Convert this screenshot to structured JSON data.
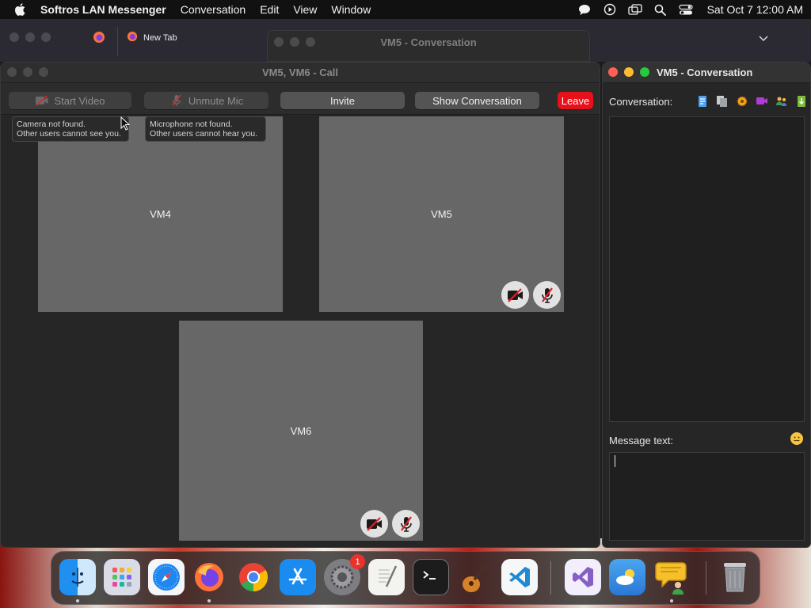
{
  "menubar": {
    "app_name": "Softros LAN Messenger",
    "items": [
      "Conversation",
      "Edit",
      "View",
      "Window"
    ],
    "clock": "Sat Oct 7  12:00 AM",
    "status_icons": [
      "chat-bubble-icon",
      "play-icon",
      "screen-mirror-icon",
      "search-icon",
      "control-center-icon"
    ]
  },
  "browser": {
    "tab_title": "New Tab"
  },
  "background_window": {
    "title": "VM5 - Conversation"
  },
  "call_window": {
    "title": "VM5, VM6 - Call",
    "toolbar": {
      "start_video": "Start Video",
      "unmute_mic": "Unmute Mic",
      "invite": "Invite",
      "show_conversation": "Show Conversation",
      "leave": "Leave"
    },
    "tooltips": {
      "camera": [
        "Camera not found.",
        "Other users cannot see you."
      ],
      "microphone": [
        "Microphone not found.",
        "Other users cannot hear you."
      ]
    },
    "participants": [
      {
        "name": "VM4"
      },
      {
        "name": "VM5"
      },
      {
        "name": "VM6"
      }
    ]
  },
  "conversation_window": {
    "title": "VM5 - Conversation",
    "conversation_label": "Conversation:",
    "message_label": "Message text:",
    "message_value": "",
    "toolbar_icons": [
      "history-icon",
      "copy-icon",
      "settings-icon",
      "video-call-icon",
      "add-users-icon",
      "file-transfer-icon"
    ]
  },
  "dock": {
    "apps": [
      "Finder",
      "Launchpad",
      "Safari",
      "Firefox",
      "Chrome",
      "App Store",
      "System Settings",
      "TextEdit",
      "Terminal",
      "GarageBand",
      "Visual Studio Code",
      "Visual Studio",
      "Weather",
      "Softros LAN Messenger",
      "Trash"
    ],
    "settings_badge": "1"
  }
}
